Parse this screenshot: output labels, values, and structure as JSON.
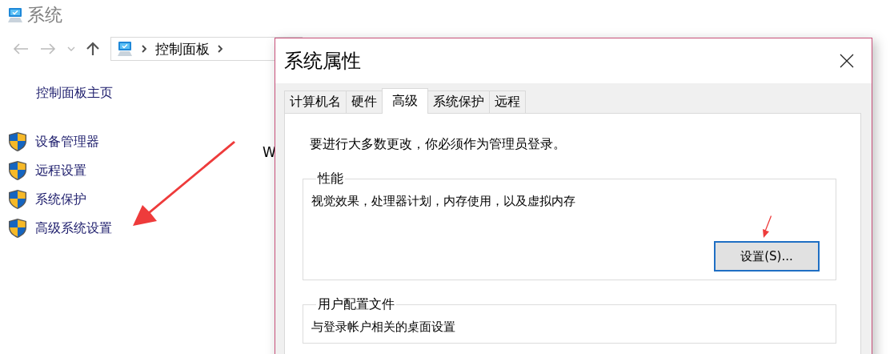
{
  "window": {
    "title": "系统"
  },
  "address_bar": {
    "crumbs": [
      "控制面板"
    ]
  },
  "sidebar": {
    "home": "控制面板主页",
    "items": [
      {
        "label": "设备管理器"
      },
      {
        "label": "远程设置"
      },
      {
        "label": "系统保护"
      },
      {
        "label": "高级系统设置"
      }
    ]
  },
  "content": {
    "fragment": "W"
  },
  "dialog": {
    "title": "系统属性",
    "tabs": [
      {
        "label": "计算机名",
        "selected": false
      },
      {
        "label": "硬件",
        "selected": false
      },
      {
        "label": "高级",
        "selected": true
      },
      {
        "label": "系统保护",
        "selected": false
      },
      {
        "label": "远程",
        "selected": false
      }
    ],
    "notice": "要进行大多数更改，你必须作为管理员登录。",
    "groups": [
      {
        "title": "性能",
        "description": "视觉效果，处理器计划，内存使用，以及虚拟内存",
        "button": "设置(S)..."
      },
      {
        "title": "用户配置文件",
        "description": "与登录帐户相关的桌面设置"
      }
    ]
  }
}
